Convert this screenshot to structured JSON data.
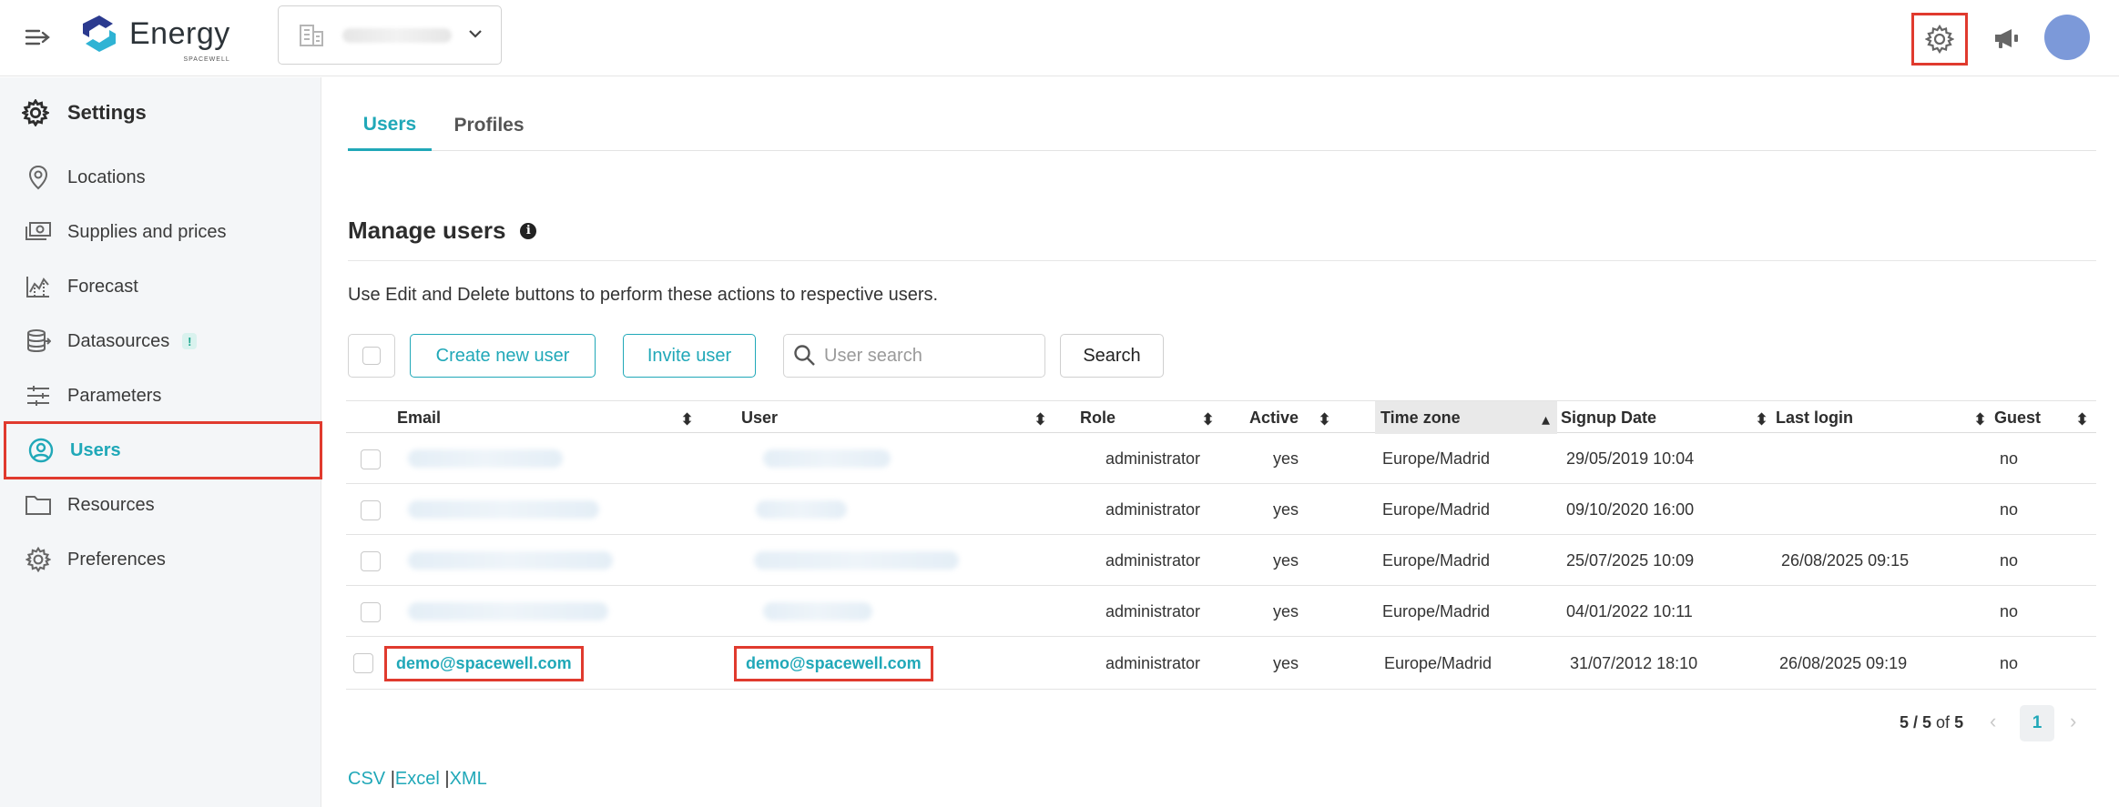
{
  "app": {
    "brand": "Energy",
    "brand_sub": "SPACEWELL"
  },
  "header": {
    "site_selector_value": "",
    "icons": {
      "menu": "menu-collapse-icon",
      "settings": "gear-icon",
      "announcements": "megaphone-icon",
      "user": "avatar"
    },
    "avatar_color": "#7c99d9"
  },
  "sidebar": {
    "title": "Settings",
    "items": [
      {
        "label": "Locations",
        "icon": "location-pin-icon"
      },
      {
        "label": "Supplies and prices",
        "icon": "money-icon"
      },
      {
        "label": "Forecast",
        "icon": "chart-icon"
      },
      {
        "label": "Datasources",
        "icon": "database-icon",
        "badge": "!"
      },
      {
        "label": "Parameters",
        "icon": "sliders-icon"
      },
      {
        "label": "Users",
        "icon": "user-circle-icon",
        "active": true
      },
      {
        "label": "Resources",
        "icon": "folder-icon"
      },
      {
        "label": "Preferences",
        "icon": "gear-icon"
      }
    ]
  },
  "tabs": [
    {
      "label": "Users",
      "active": true
    },
    {
      "label": "Profiles",
      "active": false
    }
  ],
  "section": {
    "title": "Manage users",
    "description": "Use Edit and Delete buttons to perform these actions to respective users."
  },
  "toolbar": {
    "create_label": "Create new user",
    "invite_label": "Invite user",
    "search_placeholder": "User search",
    "search_label": "Search"
  },
  "table": {
    "columns": [
      "Email",
      "User",
      "Role",
      "Active",
      "Time zone",
      "Signup Date",
      "Last login",
      "Guest"
    ],
    "sorted_column": "Time zone",
    "rows": [
      {
        "email": "",
        "user": "",
        "role": "administrator",
        "active": "yes",
        "timezone": "Europe/Madrid",
        "signup": "29/05/2019 10:04",
        "last_login": "",
        "guest": "no"
      },
      {
        "email": "",
        "user": "",
        "role": "administrator",
        "active": "yes",
        "timezone": "Europe/Madrid",
        "signup": "09/10/2020 16:00",
        "last_login": "",
        "guest": "no"
      },
      {
        "email": "",
        "user": "",
        "role": "administrator",
        "active": "yes",
        "timezone": "Europe/Madrid",
        "signup": "25/07/2025 10:09",
        "last_login": "26/08/2025 09:15",
        "guest": "no"
      },
      {
        "email": "",
        "user": "",
        "role": "administrator",
        "active": "yes",
        "timezone": "Europe/Madrid",
        "signup": "04/01/2022 10:11",
        "last_login": "",
        "guest": "no"
      },
      {
        "email": "demo@spacewell.com",
        "user": "demo@spacewell.com",
        "role": "administrator",
        "active": "yes",
        "timezone": "Europe/Madrid",
        "signup": "31/07/2012 18:10",
        "last_login": "26/08/2025 09:19",
        "guest": "no"
      }
    ]
  },
  "pagination": {
    "range": "5 / 5",
    "of_label": "of",
    "total": "5",
    "current_page": "1"
  },
  "exports": {
    "csv": "CSV",
    "excel": "Excel",
    "xml": "XML",
    "separator": "|"
  },
  "colors": {
    "accent": "#20a8b8",
    "highlight_border": "#e03a2e"
  }
}
